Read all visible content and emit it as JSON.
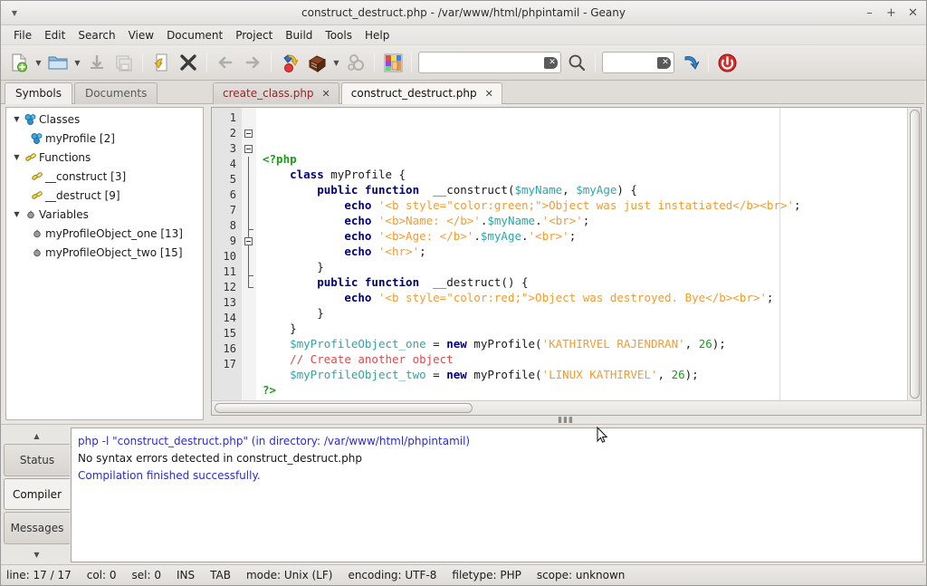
{
  "window": {
    "title": "construct_destruct.php - /var/www/html/phpintamil - Geany",
    "minimize": "–",
    "maximize": "+",
    "close": "✕",
    "menu_handle_icon": "menu-caret-icon"
  },
  "menubar": {
    "items": [
      {
        "label": "File"
      },
      {
        "label": "Edit"
      },
      {
        "label": "Search"
      },
      {
        "label": "View"
      },
      {
        "label": "Document"
      },
      {
        "label": "Project"
      },
      {
        "label": "Build"
      },
      {
        "label": "Tools"
      },
      {
        "label": "Help"
      }
    ]
  },
  "toolbar": {
    "buttons": [
      {
        "name": "new-document-icon"
      },
      {
        "name": "new-document-dropdown-icon"
      },
      {
        "name": "open-folder-icon"
      },
      {
        "name": "open-recent-dropdown-icon"
      },
      {
        "name": "save-icon"
      },
      {
        "name": "save-all-icon"
      },
      {
        "name": "revert-icon"
      },
      {
        "name": "close-document-icon"
      },
      {
        "name": "navigate-back-icon"
      },
      {
        "name": "navigate-forward-icon"
      },
      {
        "name": "compile-icon"
      },
      {
        "name": "build-icon"
      },
      {
        "name": "build-dropdown-icon"
      },
      {
        "name": "run-options-icon"
      },
      {
        "name": "color-chooser-icon"
      },
      {
        "name": "search-icon"
      },
      {
        "name": "goto-line-icon"
      },
      {
        "name": "quit-icon"
      }
    ],
    "search_value": "",
    "search_placeholder": "",
    "goto_value": "",
    "goto_placeholder": "",
    "clear_glyph": "✕"
  },
  "sidebar": {
    "tabs": [
      {
        "label": "Symbols",
        "active": true
      },
      {
        "label": "Documents",
        "active": false
      }
    ],
    "tree": [
      {
        "label": "Classes",
        "icon": "class-icon",
        "level": 0,
        "expander": "▼"
      },
      {
        "label": "myProfile [2]",
        "icon": "class-icon",
        "level": 1,
        "expander": ""
      },
      {
        "label": "Functions",
        "icon": "function-icon",
        "level": 0,
        "expander": "▼"
      },
      {
        "label": "__construct [3]",
        "icon": "function-icon",
        "level": 1,
        "expander": ""
      },
      {
        "label": "__destruct [9]",
        "icon": "function-icon",
        "level": 1,
        "expander": ""
      },
      {
        "label": "Variables",
        "icon": "variable-icon",
        "level": 0,
        "expander": "▼"
      },
      {
        "label": "myProfileObject_one [13]",
        "icon": "variable-icon",
        "level": 1,
        "expander": ""
      },
      {
        "label": "myProfileObject_two [15]",
        "icon": "variable-icon",
        "level": 1,
        "expander": ""
      }
    ]
  },
  "editor": {
    "tabs": [
      {
        "label": "create_class.php",
        "active": false,
        "close": "✕"
      },
      {
        "label": "construct_destruct.php",
        "active": true,
        "close": "✕"
      }
    ],
    "line_numbers": [
      "1",
      "2",
      "3",
      "4",
      "5",
      "6",
      "7",
      "8",
      "9",
      "10",
      "11",
      "12",
      "13",
      "14",
      "15",
      "16",
      "17"
    ],
    "fold_markers": [
      {
        "line": 2,
        "type": "box"
      },
      {
        "line": 3,
        "type": "box"
      },
      {
        "line": 4,
        "type": "line"
      },
      {
        "line": 5,
        "type": "line"
      },
      {
        "line": 6,
        "type": "line"
      },
      {
        "line": 7,
        "type": "line"
      },
      {
        "line": 8,
        "type": "end"
      },
      {
        "line": 9,
        "type": "box"
      },
      {
        "line": 10,
        "type": "line"
      },
      {
        "line": 11,
        "type": "end"
      },
      {
        "line": 12,
        "type": "end"
      }
    ],
    "code_lines": [
      [
        {
          "t": "<?php",
          "c": "c-tag"
        }
      ],
      [
        {
          "t": "    ",
          "c": "c-plain"
        },
        {
          "t": "class",
          "c": "c-kw"
        },
        {
          "t": " myProfile {",
          "c": "c-plain"
        }
      ],
      [
        {
          "t": "        ",
          "c": "c-plain"
        },
        {
          "t": "public function",
          "c": "c-kw"
        },
        {
          "t": "  __construct(",
          "c": "c-plain"
        },
        {
          "t": "$myName",
          "c": "c-var"
        },
        {
          "t": ", ",
          "c": "c-plain"
        },
        {
          "t": "$myAge",
          "c": "c-var"
        },
        {
          "t": ") {",
          "c": "c-plain"
        }
      ],
      [
        {
          "t": "            ",
          "c": "c-plain"
        },
        {
          "t": "echo",
          "c": "c-kw"
        },
        {
          "t": " ",
          "c": "c-plain"
        },
        {
          "t": "'<b style=\"color:green;\">Object was just instatiated</b><br>'",
          "c": "c-str"
        },
        {
          "t": ";",
          "c": "c-plain"
        }
      ],
      [
        {
          "t": "            ",
          "c": "c-plain"
        },
        {
          "t": "echo",
          "c": "c-kw"
        },
        {
          "t": " ",
          "c": "c-plain"
        },
        {
          "t": "'<b>Name: </b>'",
          "c": "c-str"
        },
        {
          "t": ".",
          "c": "c-plain"
        },
        {
          "t": "$myName",
          "c": "c-var"
        },
        {
          "t": ".",
          "c": "c-plain"
        },
        {
          "t": "'<br>'",
          "c": "c-str"
        },
        {
          "t": ";",
          "c": "c-plain"
        }
      ],
      [
        {
          "t": "            ",
          "c": "c-plain"
        },
        {
          "t": "echo",
          "c": "c-kw"
        },
        {
          "t": " ",
          "c": "c-plain"
        },
        {
          "t": "'<b>Age: </b>'",
          "c": "c-str"
        },
        {
          "t": ".",
          "c": "c-plain"
        },
        {
          "t": "$myAge",
          "c": "c-var"
        },
        {
          "t": ".",
          "c": "c-plain"
        },
        {
          "t": "'<br>'",
          "c": "c-str"
        },
        {
          "t": ";",
          "c": "c-plain"
        }
      ],
      [
        {
          "t": "            ",
          "c": "c-plain"
        },
        {
          "t": "echo",
          "c": "c-kw"
        },
        {
          "t": " ",
          "c": "c-plain"
        },
        {
          "t": "'<hr>'",
          "c": "c-str"
        },
        {
          "t": ";",
          "c": "c-plain"
        }
      ],
      [
        {
          "t": "        }",
          "c": "c-plain"
        }
      ],
      [
        {
          "t": "        ",
          "c": "c-plain"
        },
        {
          "t": "public function",
          "c": "c-kw"
        },
        {
          "t": "  __destruct() {",
          "c": "c-plain"
        }
      ],
      [
        {
          "t": "            ",
          "c": "c-plain"
        },
        {
          "t": "echo",
          "c": "c-kw"
        },
        {
          "t": " ",
          "c": "c-plain"
        },
        {
          "t": "'<b style=\"color:red;\">Object was destroyed. Bye</b><br>'",
          "c": "c-str"
        },
        {
          "t": ";",
          "c": "c-plain"
        }
      ],
      [
        {
          "t": "        }",
          "c": "c-plain"
        }
      ],
      [
        {
          "t": "    }",
          "c": "c-plain"
        }
      ],
      [
        {
          "t": "    ",
          "c": "c-plain"
        },
        {
          "t": "$myProfileObject_one",
          "c": "c-var"
        },
        {
          "t": " = ",
          "c": "c-plain"
        },
        {
          "t": "new",
          "c": "c-kw"
        },
        {
          "t": " myProfile(",
          "c": "c-plain"
        },
        {
          "t": "'KATHIRVEL RAJENDRAN'",
          "c": "c-str"
        },
        {
          "t": ", ",
          "c": "c-plain"
        },
        {
          "t": "26",
          "c": "c-num"
        },
        {
          "t": ");",
          "c": "c-plain"
        }
      ],
      [
        {
          "t": "    ",
          "c": "c-plain"
        },
        {
          "t": "// Create another object",
          "c": "c-com"
        }
      ],
      [
        {
          "t": "    ",
          "c": "c-plain"
        },
        {
          "t": "$myProfileObject_two",
          "c": "c-var"
        },
        {
          "t": " = ",
          "c": "c-plain"
        },
        {
          "t": "new",
          "c": "c-kw"
        },
        {
          "t": " myProfile(",
          "c": "c-plain"
        },
        {
          "t": "'LINUX KATHIRVEL'",
          "c": "c-str"
        },
        {
          "t": ", ",
          "c": "c-plain"
        },
        {
          "t": "26",
          "c": "c-num"
        },
        {
          "t": ");",
          "c": "c-plain"
        }
      ],
      [
        {
          "t": "?>",
          "c": "c-tag"
        }
      ],
      [
        {
          "t": "",
          "c": "c-plain"
        }
      ]
    ]
  },
  "message_panel": {
    "scroll_up": "▲",
    "scroll_down": "▼",
    "tabs": [
      {
        "label": "Status",
        "active": false
      },
      {
        "label": "Compiler",
        "active": true
      },
      {
        "label": "Messages",
        "active": false
      }
    ],
    "lines": [
      {
        "text": "php -l \"construct_destruct.php\" (in directory: /var/www/html/phpintamil)",
        "style": "blue"
      },
      {
        "text": "No syntax errors detected in construct_destruct.php",
        "style": "black"
      },
      {
        "text": "Compilation finished successfully.",
        "style": "blue"
      }
    ]
  },
  "statusbar": {
    "items": [
      "line: 17 / 17",
      "col: 0",
      "sel: 0",
      "INS",
      "TAB",
      "mode: Unix (LF)",
      "encoding: UTF-8",
      "filetype: PHP",
      "scope: unknown"
    ]
  },
  "colors": {
    "accent_blue": "#2b2bd4",
    "keyword": "#00007f",
    "string": "#f59b30",
    "variable": "#2fa5a5",
    "comment": "#e04a4a",
    "tag_green": "#1a9e1a"
  }
}
